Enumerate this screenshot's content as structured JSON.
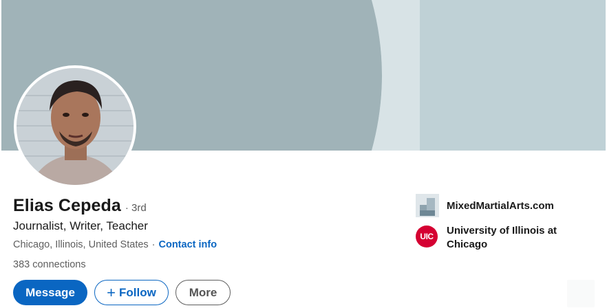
{
  "profile": {
    "name": "Elias Cepeda",
    "degree": "· 3rd",
    "headline": "Journalist, Writer, Teacher",
    "location": "Chicago, Illinois, United States",
    "location_separator": "·",
    "contact_info_label": "Contact info",
    "connections": "383 connections"
  },
  "actions": {
    "message_label": "Message",
    "follow_icon": "+",
    "follow_label": "Follow",
    "more_label": "More"
  },
  "side": {
    "items": [
      {
        "label": "MixedMartialArts.com",
        "icon": "company-logo-icon"
      },
      {
        "label": "University of Illinois at Chicago",
        "icon": "uic-logo-icon",
        "logo_text": "UIC"
      }
    ]
  },
  "colors": {
    "accent": "#0a66c2",
    "banner_dark": "#a0b3b8",
    "banner_light": "#bfd1d6",
    "uic_red": "#d50032"
  }
}
